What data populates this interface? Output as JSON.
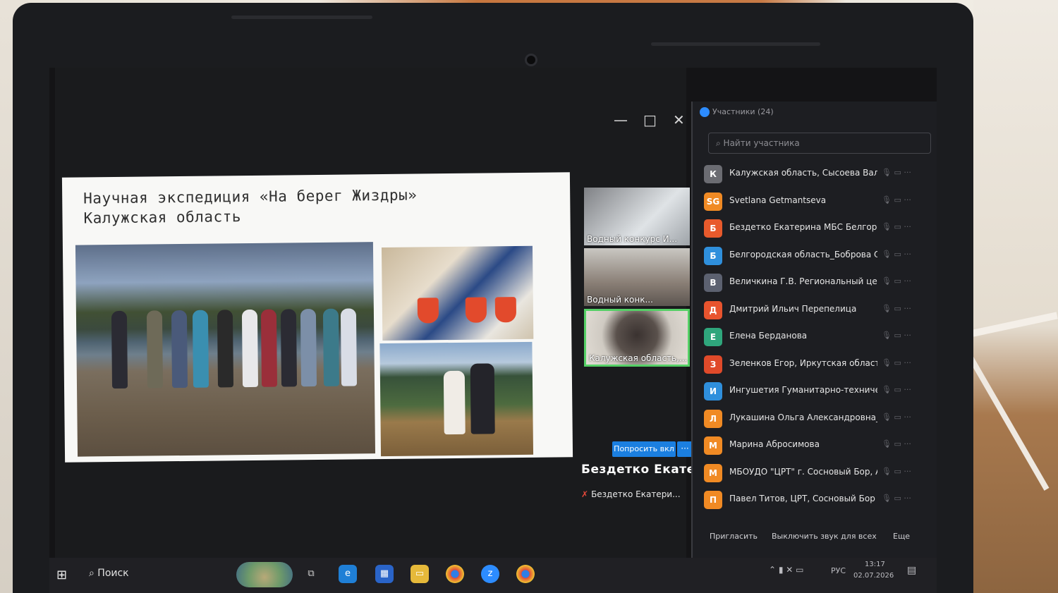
{
  "window": {
    "minimize": "—",
    "maximize": "□",
    "close": "✕"
  },
  "slide": {
    "title_line1": "Научная экспедиция «На берег Жиздры»",
    "title_line2": "Калужская область"
  },
  "thumbnails": [
    {
      "label": "Водный конкурс И..."
    },
    {
      "label": "Водный конк..."
    },
    {
      "label": "Калужская область,..."
    }
  ],
  "speaker": {
    "ask_button": "Попросить вкл",
    "more_button": "···",
    "name": "Бездетко Екате...",
    "sub": "Бездетко Екатери..."
  },
  "participants": {
    "title": "Участники (24)",
    "search_placeholder": "Найти участника",
    "items": [
      {
        "initial": "К",
        "name": "Калужская область, Сысоева Валер...",
        "color": "#6b6c72"
      },
      {
        "initial": "SG",
        "name": "Svetlana Getmantseva",
        "color": "#f08a24"
      },
      {
        "initial": "Б",
        "name": "Бездетко Екатерина МБС Белгород",
        "color": "#e85a2c"
      },
      {
        "initial": "Б",
        "name": "Белгородская область_Боброва О...",
        "color": "#2f8fdc"
      },
      {
        "initial": "В",
        "name": "Величкина Г.В. Региональный цент...",
        "color": "#5c6170"
      },
      {
        "initial": "Д",
        "name": "Дмитрий Ильич Перепелица",
        "color": "#e8542e"
      },
      {
        "initial": "Е",
        "name": "Елена Берданова",
        "color": "#2fa67c"
      },
      {
        "initial": "З",
        "name": "Зеленков Егор, Иркутская область",
        "color": "#e04a2a"
      },
      {
        "initial": "И",
        "name": "Ингушетия Гуманитарно-технический к...",
        "color": "#2f8fdc"
      },
      {
        "initial": "Л",
        "name": "Лукашина Ольга Александровна_В...",
        "color": "#f08a24"
      },
      {
        "initial": "М",
        "name": "Марина Абросимова",
        "color": "#f08a24"
      },
      {
        "initial": "М",
        "name": "МБОУДО \"ЦРТ\" г. Сосновый Бор, Анна ...",
        "color": "#f08a24"
      },
      {
        "initial": "П",
        "name": "Павел Титов, ЦРТ, Сосновый Бор",
        "color": "#f08a24"
      }
    ],
    "invite": "Пригласить",
    "mute_all": "Выключить звук для всех",
    "more": "Еще"
  },
  "taskbar": {
    "search": "Поиск",
    "lang": "РУС",
    "time": "13:17",
    "date": "02.07.2026"
  }
}
